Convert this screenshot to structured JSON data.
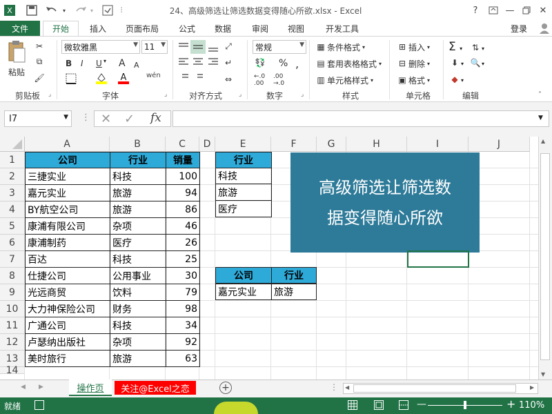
{
  "window": {
    "title": "24、高级筛选让筛选数据变得随心所欲.xlsx - Excel",
    "help": "?",
    "login": "登录"
  },
  "ribbon": {
    "tabs": [
      "文件",
      "开始",
      "插入",
      "页面布局",
      "公式",
      "数据",
      "审阅",
      "视图",
      "开发工具"
    ],
    "clipboard": {
      "paste": "粘贴",
      "label": "剪贴板"
    },
    "font": {
      "name": "微软雅黑",
      "size": "11",
      "bold": "B",
      "italic": "I",
      "underline": "U",
      "grow": "A",
      "shrink": "A",
      "label": "字体"
    },
    "align": {
      "label": "对齐方式"
    },
    "number": {
      "format": "常规",
      "percent": "%",
      "comma": ",",
      "label": "数字"
    },
    "styles": {
      "cond": "条件格式",
      "table": "套用表格格式",
      "cell": "单元格样式",
      "label": "样式"
    },
    "cells": {
      "insert": "插入",
      "delete": "删除",
      "format": "格式",
      "label": "单元格"
    },
    "editing": {
      "label": "编辑"
    }
  },
  "formula_bar": {
    "name_box": "I7",
    "fx": "fx",
    "value": ""
  },
  "grid": {
    "columns": [
      "A",
      "B",
      "C",
      "D",
      "E",
      "F",
      "G",
      "H",
      "I",
      "J"
    ],
    "rows": [
      "1",
      "2",
      "3",
      "4",
      "5",
      "6",
      "7",
      "8",
      "9",
      "10",
      "11",
      "12",
      "13",
      "14"
    ],
    "main_table": {
      "headers": [
        "公司",
        "行业",
        "销量"
      ],
      "rows": [
        [
          "三捷实业",
          "科技",
          "100"
        ],
        [
          "嘉元实业",
          "旅游",
          "94"
        ],
        [
          "BY航空公司",
          "旅游",
          "86"
        ],
        [
          "康浦有限公司",
          "杂项",
          "46"
        ],
        [
          "康浦制药",
          "医疗",
          "26"
        ],
        [
          "百达",
          "科技",
          "25"
        ],
        [
          "仕捷公司",
          "公用事业",
          "30"
        ],
        [
          "光远商贸",
          "饮料",
          "79"
        ],
        [
          "大力神保险公司",
          "财务",
          "98"
        ],
        [
          "广通公司",
          "科技",
          "34"
        ],
        [
          "卢瑟纳出版社",
          "杂项",
          "92"
        ],
        [
          "美时旅行",
          "旅游",
          "63"
        ]
      ]
    },
    "criteria": {
      "header": "行业",
      "values": [
        "科技",
        "旅游",
        "医疗"
      ]
    },
    "result": {
      "headers": [
        "公司",
        "行业"
      ],
      "row": [
        "嘉元实业",
        "旅游"
      ]
    },
    "banner": {
      "line1": "高级筛选让筛选数",
      "line2": "据变得随心所欲"
    }
  },
  "sheets": {
    "active": "操作页",
    "other": "关注@Excel之恋",
    "add": "+"
  },
  "status": {
    "ready": "就绪",
    "zoom": "110%"
  },
  "colors": {
    "excel_green": "#217346",
    "header_blue": "#2eaad9",
    "banner": "#2e7b99",
    "sheet_red": "#ff0000"
  }
}
